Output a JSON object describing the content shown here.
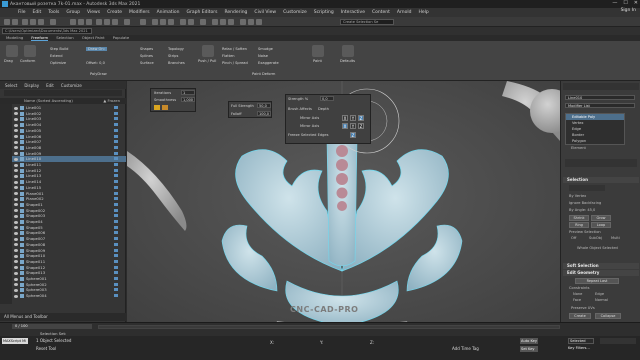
{
  "window": {
    "title": "Акантовый розетка 7k-01.max - Autodesk 3ds Max 2021",
    "controls": [
      "—",
      "☐",
      "✕"
    ]
  },
  "menubar": {
    "items": [
      "File",
      "Edit",
      "Tools",
      "Group",
      "Views",
      "Create",
      "Modifiers",
      "Animation",
      "Graph Editors",
      "Rendering",
      "Civil View",
      "Customize",
      "Scripting",
      "Interactive",
      "Content",
      "Arnold",
      "Help"
    ],
    "signin": "Sign In",
    "workspace_label": "Workspaces:",
    "workspace_value": "3D Menu and Tool..."
  },
  "toolbar": {
    "path": "C:\\Users\\Optimized\\Documents\\3ds Max 2021",
    "selection_set": "Create Selection Se"
  },
  "ribbon": {
    "tabs": [
      "Modeling",
      "Freeform",
      "Selection",
      "Object Paint",
      "Populate"
    ],
    "active_tab": "Freeform",
    "buttons": [
      {
        "label": "Drag"
      },
      {
        "label": "Conform"
      },
      {
        "label": "Step Build"
      },
      {
        "label": "Extend"
      },
      {
        "label": "Optimize"
      },
      {
        "label": "Draw On:"
      },
      {
        "label": "Offset: 0,0"
      },
      {
        "label": "Shapes"
      },
      {
        "label": "Splines"
      },
      {
        "label": "Surface"
      },
      {
        "label": "Topology"
      },
      {
        "label": "Strips"
      },
      {
        "label": "Branches"
      },
      {
        "label": "Push / Pull"
      },
      {
        "label": "Relax / Soften"
      },
      {
        "label": "Flatten"
      },
      {
        "label": "Pinch / Spread"
      },
      {
        "label": "Smudge"
      },
      {
        "label": "Noise"
      },
      {
        "label": "Exaggerate"
      },
      {
        "label": "Paint"
      },
      {
        "label": "Defaults"
      }
    ],
    "group_labels": [
      "PolyDraw",
      "Paint Deform"
    ]
  },
  "scene_explorer": {
    "menu": [
      "Select",
      "Display",
      "Edit",
      "Customize"
    ],
    "column_header": "Name (Sorted Ascending)",
    "frozen_header": "▲ Frozen",
    "rows": [
      {
        "name": "Line001",
        "selected": false
      },
      {
        "name": "Line002",
        "selected": false
      },
      {
        "name": "Line003",
        "selected": false
      },
      {
        "name": "Line004",
        "selected": false
      },
      {
        "name": "Line005",
        "selected": false
      },
      {
        "name": "Line006",
        "selected": false
      },
      {
        "name": "Line007",
        "selected": false
      },
      {
        "name": "Line008",
        "selected": false
      },
      {
        "name": "Line009",
        "selected": false
      },
      {
        "name": "Line010",
        "selected": true
      },
      {
        "name": "Line011",
        "selected": false
      },
      {
        "name": "Line012",
        "selected": false
      },
      {
        "name": "Line013",
        "selected": false
      },
      {
        "name": "Line014",
        "selected": false
      },
      {
        "name": "Line015",
        "selected": false
      },
      {
        "name": "Plane001",
        "selected": false
      },
      {
        "name": "Plane002",
        "selected": false
      },
      {
        "name": "Shape01",
        "selected": false
      },
      {
        "name": "Shape002",
        "selected": false
      },
      {
        "name": "Shape003",
        "selected": false
      },
      {
        "name": "Shape04",
        "selected": false
      },
      {
        "name": "Shape05",
        "selected": false
      },
      {
        "name": "Shape006",
        "selected": false
      },
      {
        "name": "Shape007",
        "selected": false
      },
      {
        "name": "Shape008",
        "selected": false
      },
      {
        "name": "Shape009",
        "selected": false
      },
      {
        "name": "Shape010",
        "selected": false
      },
      {
        "name": "Shape011",
        "selected": false
      },
      {
        "name": "Shape012",
        "selected": false
      },
      {
        "name": "Shape013",
        "selected": false
      },
      {
        "name": "Sphere001",
        "selected": false
      },
      {
        "name": "Sphere002",
        "selected": false
      },
      {
        "name": "Sphere003",
        "selected": false
      },
      {
        "name": "Sphere004",
        "selected": false
      }
    ],
    "bottom_label": "All Menus and Toolbar"
  },
  "popups": {
    "iterations_label": "Iterations",
    "iterations_value": "1",
    "strength_small_label": "Smoothness",
    "strength_small_value": "1,000",
    "full_strength_label": "Full Strength",
    "full_strength_value": "50,0",
    "falloff_label": "Falloff",
    "falloff_value": "100,0",
    "strength_label": "Strength %",
    "strength_value": "0,0",
    "brush_label": "Brush Affects",
    "brush_value": "Depth",
    "mirror_axis_1": "Mirror Axis",
    "mirror_axis_2": "Mirror Axis",
    "freeze_edges": "Freeze Selected Edges",
    "axis_letters": [
      "X",
      "Y",
      "Z"
    ]
  },
  "command_panel": {
    "object_name": "Line010",
    "modifier_list": "Modifier List",
    "stack": [
      "Editable Poly",
      "Vertex",
      "Edge",
      "Border",
      "Polygon",
      "Element"
    ],
    "active_stack": "Editable Poly",
    "selection_section": "Selection",
    "by_vertex": "By Vertex",
    "ignore_backfacing": "Ignore Backfacing",
    "by_angle": "By Angle: 45,0",
    "shrink": "Shrink",
    "grow": "Grow",
    "ring": "Ring",
    "loop": "Loop",
    "preview_label": "Preview Selection",
    "preview_off": "Off",
    "preview_subobj": "SubObj",
    "preview_multi": "Multi",
    "whole_selected": "Whole Object Selected",
    "soft_selection": "Soft Selection",
    "edit_geometry": "Edit Geometry",
    "repeat_last": "Repeat Last",
    "constraints": "Constraints",
    "c_none": "None",
    "c_edge": "Edge",
    "c_face": "Face",
    "c_normal": "Normal",
    "preserve_uvs": "Preserve UVs",
    "create": "Create",
    "collapse": "Collapse"
  },
  "timeline": {
    "frame_counter": "0 / 100",
    "selection_set_label": "Selection Set:",
    "object_selected": "1 Object Selected",
    "coord_x": "X:",
    "coord_y": "Y:",
    "coord_z": "Z:",
    "auto_key": "Auto Key",
    "selected": "Selected",
    "set_key": "Set Key",
    "key_filters": "Key Filters...",
    "add_time_tag": "Add Time Tag",
    "maxscript": "MAXScript Mi",
    "reset_tool": "Reset Tool"
  },
  "watermark": "CNC-CAD-PRO",
  "colors": {
    "accent": "#4a80b0",
    "selection_row": "#4d6f8c",
    "model_tint": "#b8d4df",
    "model_outline": "#6fd9f0"
  }
}
